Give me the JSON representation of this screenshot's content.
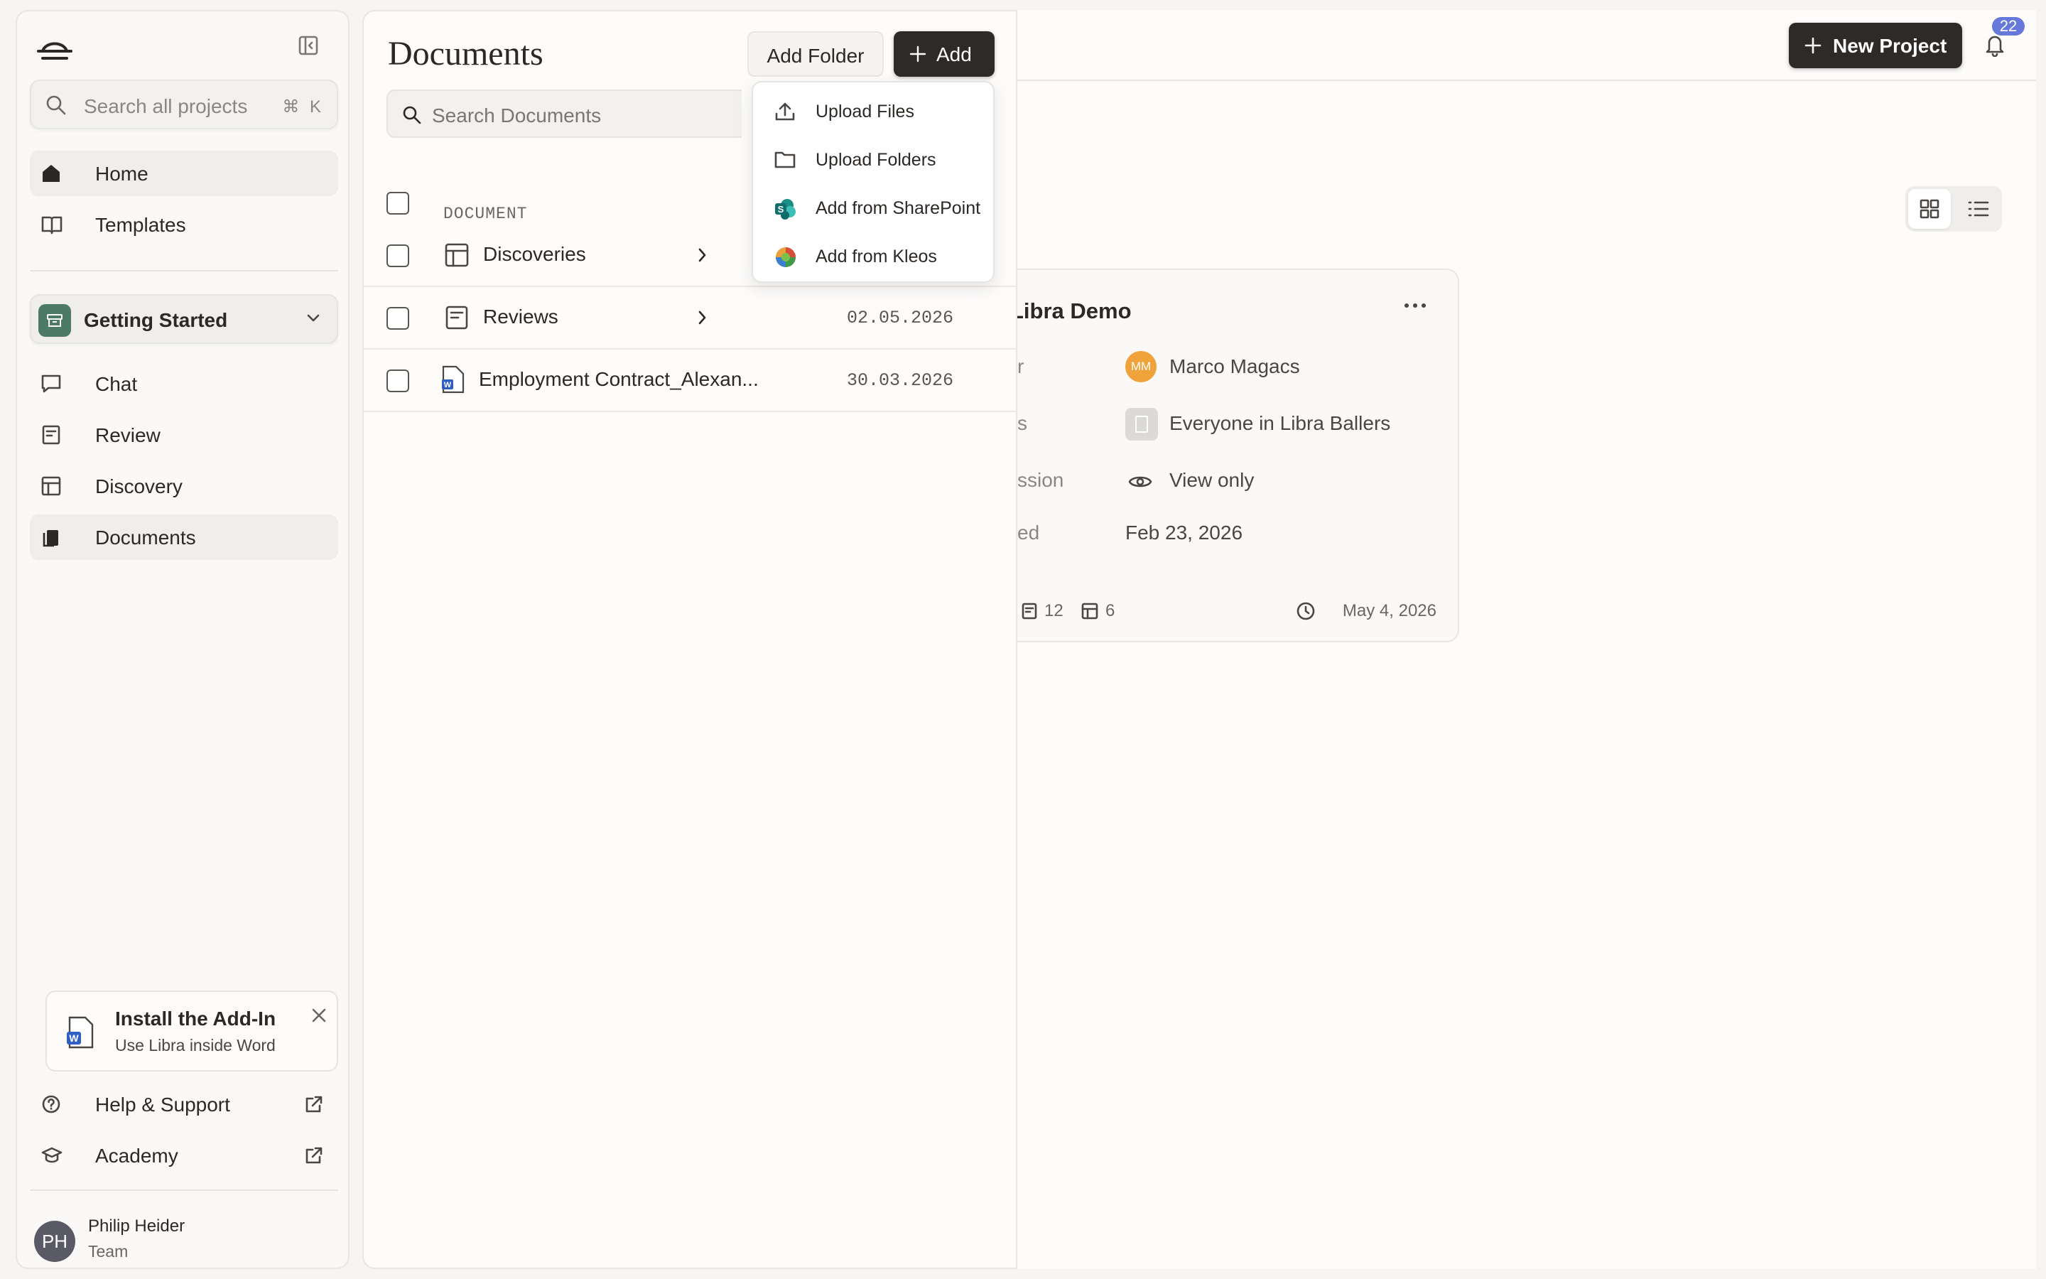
{
  "sidebar": {
    "search": {
      "placeholder": "Search all projects",
      "shortcut": "⌘ K"
    },
    "nav": [
      {
        "label": "Home"
      },
      {
        "label": "Templates"
      }
    ],
    "project": {
      "label": "Getting Started"
    },
    "project_nav": [
      {
        "label": "Chat"
      },
      {
        "label": "Review"
      },
      {
        "label": "Discovery"
      },
      {
        "label": "Documents"
      }
    ],
    "addin": {
      "title": "Install the Add-In",
      "subtitle": "Use Libra inside Word"
    },
    "footer_links": [
      {
        "label": "Help & Support"
      },
      {
        "label": "Academy"
      }
    ],
    "user": {
      "initials": "PH",
      "name": "Philip Heider",
      "role": "Team"
    }
  },
  "topbar": {
    "new_project_label": "New Project",
    "notification_count": "22"
  },
  "project_card": {
    "title": "Libra Demo",
    "rows": [
      {
        "key": "r",
        "value": "Marco Magacs",
        "avatar": "MM"
      },
      {
        "key": "s",
        "value": "Everyone in Libra Ballers"
      },
      {
        "key": "ssion",
        "value": "View only"
      },
      {
        "key": "ed",
        "value": "Feb 23, 2026"
      }
    ],
    "stats": {
      "reviews": "12",
      "tables": "6",
      "updated": "May 4, 2026"
    }
  },
  "documents": {
    "title": "Documents",
    "add_folder_label": "Add Folder",
    "add_label": "Add",
    "search_placeholder": "Search Documents",
    "column_document": "DOCUMENT",
    "rows": [
      {
        "name": "Discoveries",
        "date": ""
      },
      {
        "name": "Reviews",
        "date": "02.05.2026"
      },
      {
        "name": "Employment Contract_Alexan...",
        "date": "30.03.2026"
      }
    ]
  },
  "add_menu": {
    "items": [
      {
        "label": "Upload Files"
      },
      {
        "label": "Upload Folders"
      },
      {
        "label": "Add from SharePoint"
      },
      {
        "label": "Add from Kleos"
      }
    ]
  },
  "colors": {
    "accent_dark": "#2e2a27",
    "badge_blue": "#6678d9",
    "project_green": "#4d7a66",
    "avatar_orange": "#f0a33a"
  }
}
